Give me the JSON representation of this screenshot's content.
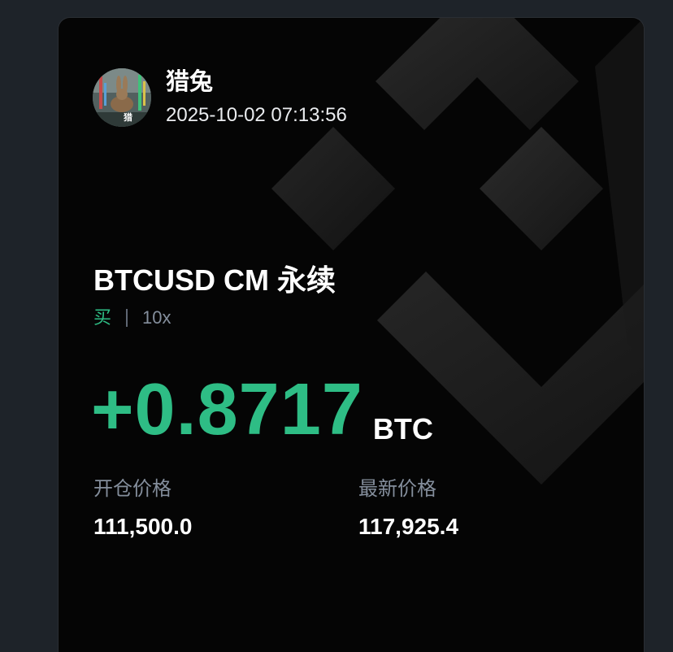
{
  "post": {
    "username": "猎兔",
    "timestamp": "2025-10-02 07:13:56"
  },
  "position": {
    "symbol": "BTCUSD CM 永续",
    "side": "买",
    "leverage": "10x",
    "pnl": "+0.8717",
    "pnl_unit": "BTC",
    "entry_label": "开仓价格",
    "entry_price": "111,500.0",
    "last_label": "最新价格",
    "last_price": "117,925.4"
  },
  "colors": {
    "positive": "#2ebd85",
    "card_bg": "#050505",
    "page_bg": "#1e2329",
    "muted": "#848e9c"
  },
  "icons": {
    "avatar": "rabbit-avatar-icon",
    "background": "exchange-logo-icon"
  }
}
